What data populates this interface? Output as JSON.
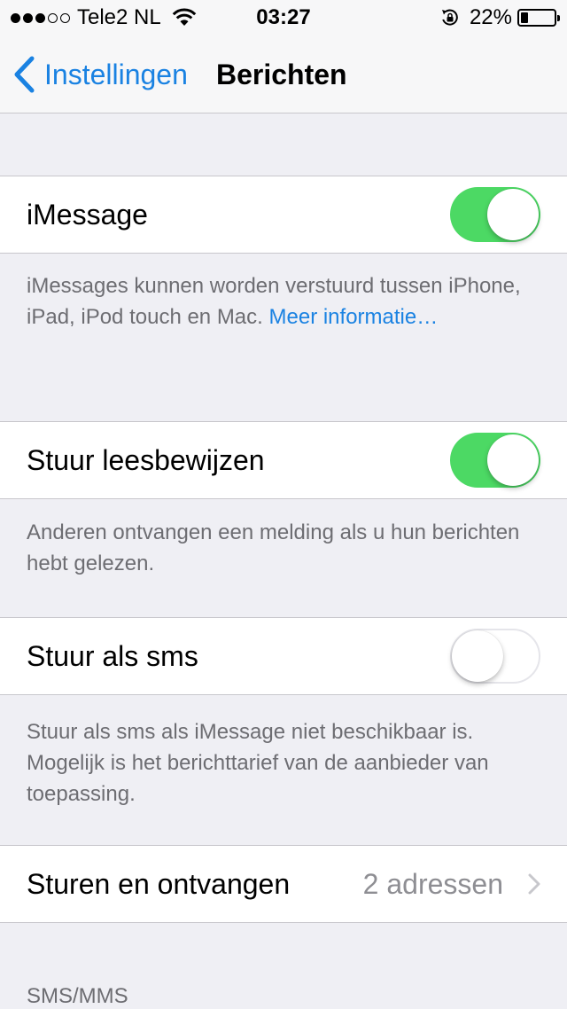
{
  "status_bar": {
    "signal_strength": "3 of 5 bars",
    "carrier": "Tele2 NL",
    "time": "03:27",
    "battery_percent": "22%",
    "battery_level": 0.22,
    "icons": [
      "signal-dots-icon",
      "wifi-icon",
      "rotation-lock-icon",
      "battery-icon"
    ]
  },
  "nav": {
    "back_label": "Instellingen",
    "title": "Berichten"
  },
  "settings": {
    "imessage": {
      "label": "iMessage",
      "on": true,
      "footer_text": "iMessages kunnen worden verstuurd tussen iPhone, iPad, iPod touch en Mac. ",
      "footer_link": "Meer informatie…"
    },
    "read_receipts": {
      "label": "Stuur leesbewijzen",
      "on": true,
      "footer_text": "Anderen ontvangen een melding als u hun berichten hebt gelezen."
    },
    "send_as_sms": {
      "label": "Stuur als sms",
      "on": false,
      "footer_text": "Stuur als sms als iMessage niet beschikbaar is. Mogelijk is het berichttarief van de aanbieder van toepassing."
    },
    "send_receive": {
      "label": "Sturen en ontvangen",
      "detail": "2 adressen"
    }
  },
  "sms_mms_header": "SMS/MMS",
  "colors": {
    "accent": "#1a82e2",
    "toggle_on": "#4cd964",
    "background": "#efeff4",
    "footer_text": "#6d6d72"
  }
}
